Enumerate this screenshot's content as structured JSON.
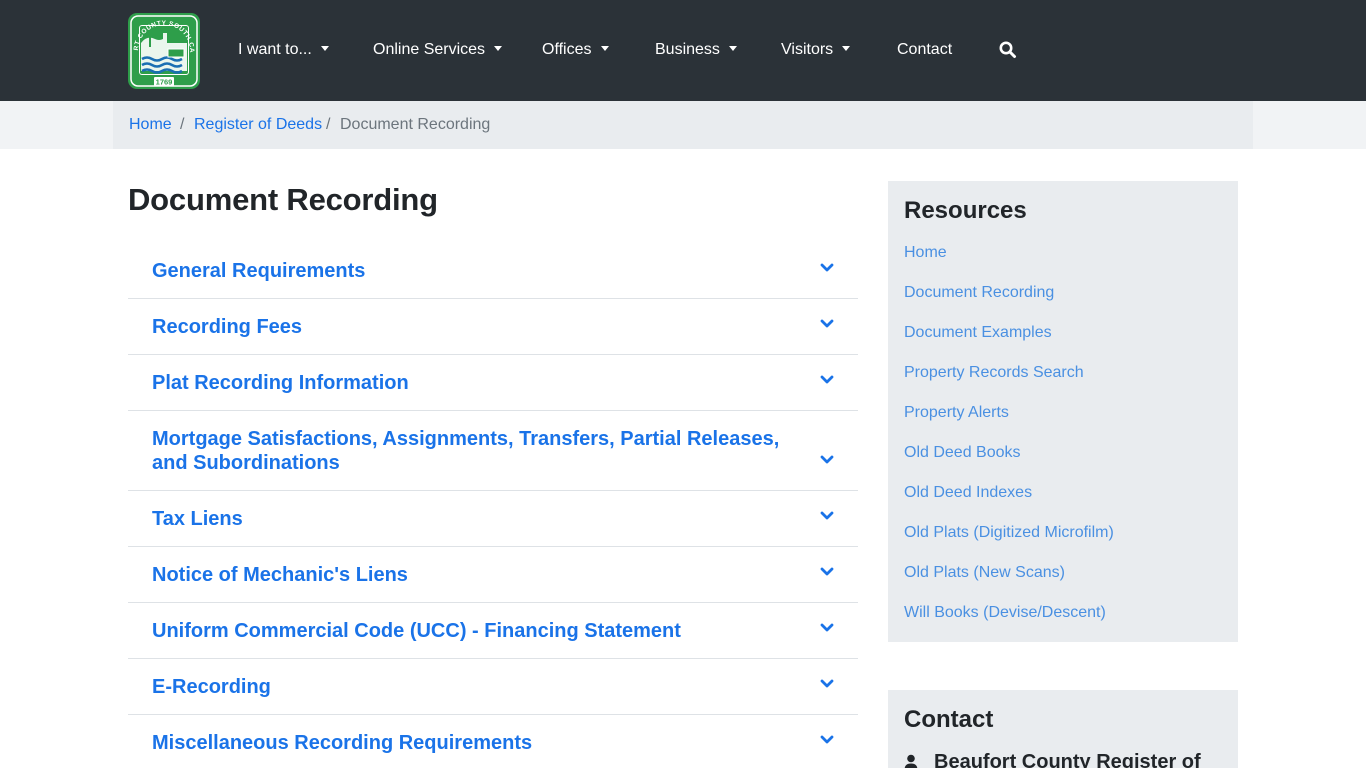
{
  "colors": {
    "navbar": "#2b3238",
    "link": "#1a73e8",
    "sidebar_link": "#4a90e2",
    "sidebar_bg": "#e9ecef",
    "logo_green": "#2e9e4a"
  },
  "header": {
    "logo": {
      "ring_text": "BEAUFORT COUNTY SOUTH CAROLINA",
      "year": "1769"
    },
    "nav": [
      {
        "label": "I want to...",
        "dropdown": true
      },
      {
        "label": "Online Services",
        "dropdown": true
      },
      {
        "label": "Offices",
        "dropdown": true
      },
      {
        "label": "Business",
        "dropdown": true
      },
      {
        "label": "Visitors",
        "dropdown": true
      },
      {
        "label": "Contact",
        "dropdown": false
      }
    ],
    "search_icon": "search-icon"
  },
  "breadcrumb": {
    "items": [
      "Home",
      "Register of Deeds"
    ],
    "current": "Document Recording",
    "separator": "/"
  },
  "main": {
    "title": "Document Recording",
    "accordion": [
      {
        "label": "General Requirements"
      },
      {
        "label": "Recording Fees"
      },
      {
        "label": "Plat Recording Information"
      },
      {
        "label": "Mortgage Satisfactions, Assignments, Transfers, Partial Releases, and Subordinations"
      },
      {
        "label": "Tax Liens"
      },
      {
        "label": "Notice of Mechanic's Liens"
      },
      {
        "label": "Uniform Commercial Code (UCC) - Financing Statement"
      },
      {
        "label": "E-Recording"
      },
      {
        "label": "Miscellaneous Recording Requirements"
      }
    ],
    "chevron_icon": "chevron-down-icon"
  },
  "sidebar": {
    "resources": {
      "title": "Resources",
      "links": [
        "Home",
        "Document Recording",
        "Document Examples",
        "Property Records Search",
        "Property Alerts",
        "Old Deed Books",
        "Old Deed Indexes",
        "Old Plats (Digitized Microfilm)",
        "Old Plats (New Scans)",
        "Will Books (Devise/Descent)"
      ]
    },
    "contact": {
      "title": "Contact",
      "name": "Beaufort County Register of",
      "icon": "user-icon"
    }
  }
}
